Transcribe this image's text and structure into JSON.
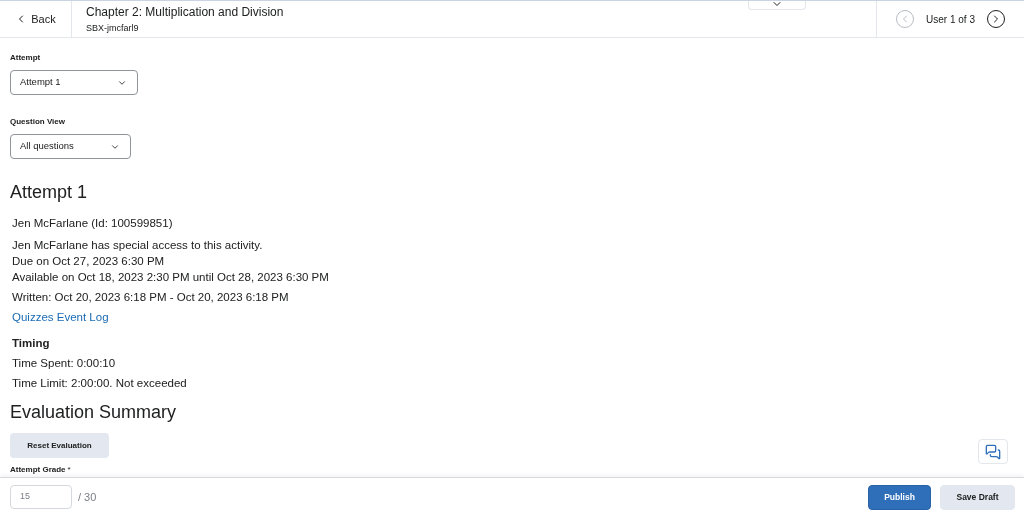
{
  "header": {
    "back": "Back",
    "title": "Chapter 2: Multiplication and Division",
    "subtitle": "SBX-jmcfarl9",
    "user_nav": "User 1 of 3"
  },
  "filters": [
    {
      "label": "Attempt",
      "value": "Attempt 1"
    },
    {
      "label": "Question View",
      "value": "All questions"
    }
  ],
  "attempt": {
    "heading": "Attempt 1",
    "student": "Jen McFarlane (Id: 100599851)",
    "lines": [
      "Jen McFarlane has special access to this activity.",
      "Due on Oct 27, 2023 6:30 PM",
      "Available on Oct 18, 2023 2:30 PM until Oct 28, 2023 6:30 PM"
    ],
    "written": "Written: Oct 20, 2023 6:18 PM - Oct 20, 2023 6:18 PM",
    "link": "Quizzes Event Log"
  },
  "timing": {
    "heading": "Timing",
    "lines": [
      "Time Spent: 0:00:10",
      "Time Limit: 2:00:00. Not exceeded"
    ]
  },
  "evaluation": {
    "heading": "Evaluation Summary",
    "reset": "Reset Evaluation",
    "grade_label": "Attempt Grade",
    "required_mark": "*",
    "grade_value": "15",
    "grade_total": "/ 30"
  },
  "footer": {
    "buttons": [
      {
        "label": "Publish",
        "kind": "primary"
      },
      {
        "label": "Save Draft",
        "kind": "secondary"
      }
    ]
  }
}
